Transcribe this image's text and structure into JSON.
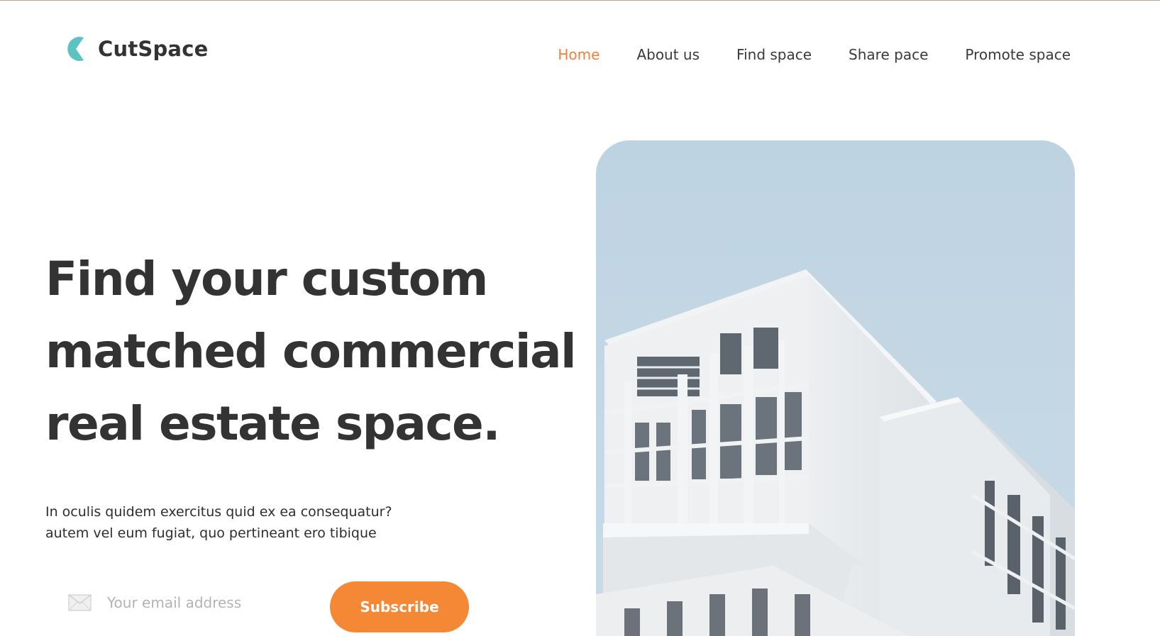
{
  "brand": {
    "name": "CutSpace",
    "logo_icon": "c-shape-logo-icon",
    "logo_color": "#5cc3c3"
  },
  "nav": {
    "items": [
      {
        "label": "Home",
        "active": true
      },
      {
        "label": "About us",
        "active": false
      },
      {
        "label": "Find space",
        "active": false
      },
      {
        "label": "Share pace",
        "active": false
      },
      {
        "label": "Promote space",
        "active": false
      }
    ]
  },
  "hero": {
    "title_lines": [
      "Find your custom",
      "matched commercial",
      "real estate space."
    ],
    "description_lines": [
      "In oculis quidem exercitus quid ex ea consequatur?",
      "autem vel eum fugiat, quo pertineant ero tibique"
    ],
    "image_icon": "building-photo"
  },
  "subscribe": {
    "email_placeholder": "Your email address",
    "email_value": "",
    "email_icon": "envelope-icon",
    "button_label": "Subscribe"
  },
  "colors": {
    "accent": "#f58835",
    "nav_active": "#f0803c",
    "text": "#333333",
    "logo": "#5cc3c3",
    "sky": "#c3d6e3"
  }
}
